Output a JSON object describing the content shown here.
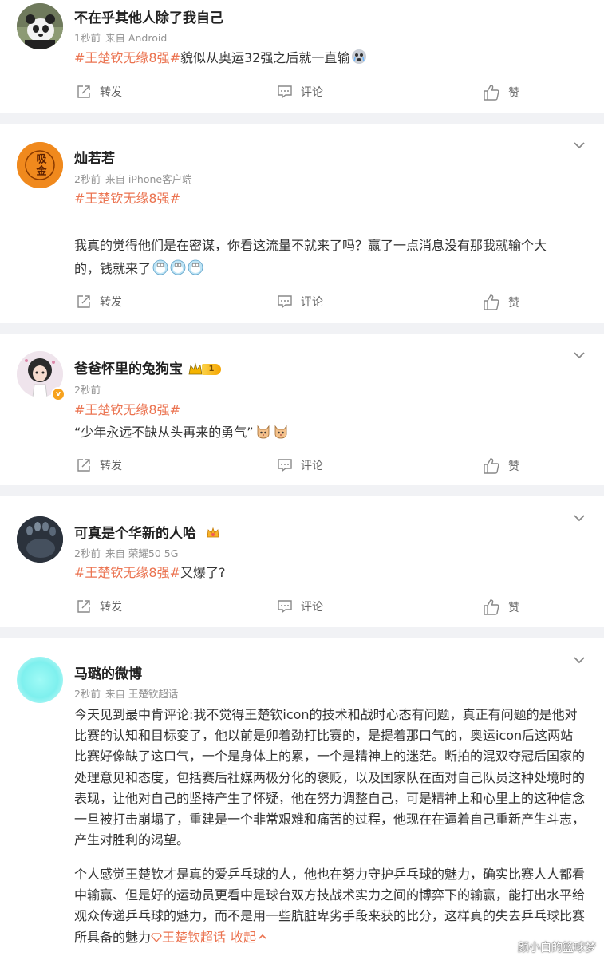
{
  "posts": [
    {
      "username": "不在乎其他人除了我自己",
      "time": "1秒前",
      "source": "来自 Android",
      "topic": "#王楚钦无缘8强#",
      "text": "貌似从奥运32强之后就一直输"
    },
    {
      "username": "灿若若",
      "time": "2秒前",
      "source": "来自 iPhone客户端",
      "topic": "#王楚钦无缘8强#",
      "avatar_text": "吸金",
      "line1": "我真的觉得他们是在密谋，你看这流量不就来了吗？赢了一点消息没有那我就输个大",
      "line2": "的，钱就来了"
    },
    {
      "username": "爸爸怀里的兔狗宝",
      "time": "2秒前",
      "level": "1",
      "verified_mark": "v",
      "topic": "#王楚钦无缘8强#",
      "text": "“少年永远不缺从头再来的勇气”"
    },
    {
      "username": "可真是个华新的人哈",
      "time": "2秒前",
      "source": "来自 荣耀50 5G",
      "topic": "#王楚钦无缘8强#",
      "text": "又爆了?"
    },
    {
      "username": "马璐的微博",
      "time": "2秒前",
      "source": "来自 王楚钦超话",
      "paragraph1": "今天见到最中肯评论:我不觉得王楚钦icon的技术和战时心态有问题，真正有问题的是他对比赛的认知和目标变了，他以前是卯着劲打比赛的，是提着那口气的，奥运icon后这两站比赛好像缺了这口气，一个是身体上的累，一个是精神上的迷茫。断拍的混双夺冠后国家的处理意见和态度，包括赛后社媒两极分化的褒贬，以及国家队在面对自己队员这种处境时的表现，让他对自己的坚持产生了怀疑，他在努力调整自己，可是精神上和心里上的这种信念一旦被打击崩塌了，重建是一个非常艰难和痛苦的过程，他现在在逼着自己重新产生斗志，产生对胜利的渴望。",
      "paragraph2": "个人感觉王楚钦才是真的爱乒乓球的人，他也在努力守护乒乓球的魅力，确实比赛人人都看中输赢、但是好的运动员更看中是球台双方技战术实力之间的博弈下的输赢，能打出水平给观众传递乒乓球的魅力，而不是用一些肮脏卑劣手段来获的比分，这样真的失去乒乓球比赛所具备的魅力",
      "supertopic_link": "王楚钦超话",
      "collapse_label": "收起"
    }
  ],
  "actions": {
    "repost": "转发",
    "comment": "评论",
    "like": "赞"
  },
  "watermark": "颜小白的篮球梦",
  "colors": {
    "topic": "#eb7350",
    "background": "#f1f2f5",
    "card": "#ffffff"
  }
}
